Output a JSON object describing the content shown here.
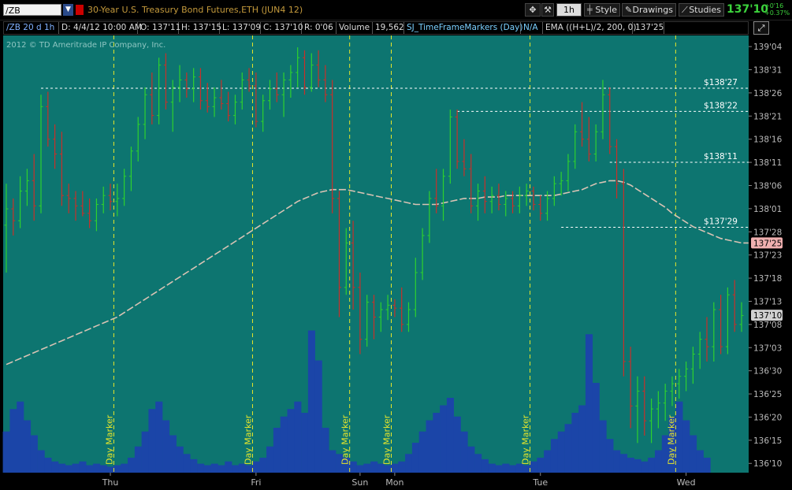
{
  "toolbar": {
    "symbol": "/ZB",
    "description": "30-Year U.S. Treasury Bond Futures,ETH (JUN4 12)",
    "timeframe": "1h",
    "style_label": "Style",
    "drawings_label": "Drawings",
    "studies_label": "Studies",
    "last_price": "137'10",
    "change_abs": "+0'16",
    "change_pct": "+0.37%"
  },
  "infobar": {
    "chart_id": "/ZB 20 d 1h",
    "date": "D: 4/4/12 10:00 AM",
    "open": "O: 137'11",
    "high": "H: 137'15",
    "low": "L: 137'09",
    "close": "C: 137'10",
    "range": "R: 0'06",
    "volume_label": "Volume",
    "volume_value": "19,562",
    "study_name": "SJ_TimeFrameMarkers (Day)",
    "study_value": "N/A",
    "ema_label": "EMA ((H+L)/2, 200, 0)",
    "ema_value": "137'25"
  },
  "copyright": "2012 © TD Ameritrade IP Company, Inc.",
  "colors": {
    "background": "#0d7570",
    "up_bar": "#2ed12e",
    "down_bar": "#c8302a",
    "doji_bar": "#e6e6e6",
    "volume": "#1b45a8",
    "marker_line": "#e6e62a",
    "ema_line": "#d9c3b4",
    "price_axis_bg": "#000000",
    "ema_badge": "#f0b0b0",
    "last_badge": "#d0d0d0"
  },
  "chart_data": {
    "type": "line",
    "title": "30-Year U.S. Treasury Bond Futures,ETH (JUN4 12)",
    "bar_interval": "1h",
    "ylim": [
      136.25,
      139.2
    ],
    "y_ticks": [
      "139'04",
      "138'31",
      "138'26",
      "138'21",
      "138'16",
      "138'11",
      "138'06",
      "138'01",
      "137'28",
      "137'23",
      "137'18",
      "137'13",
      "137'08",
      "137'03",
      "136'30",
      "136'25",
      "136'20",
      "136'15",
      "136'10"
    ],
    "x_tick_labels": [
      {
        "label": "Thu",
        "i": 15
      },
      {
        "label": "Fri",
        "i": 36
      },
      {
        "label": "Sun",
        "i": 51
      },
      {
        "label": "Mon",
        "i": 56
      },
      {
        "label": "Tue",
        "i": 77
      },
      {
        "label": "Wed",
        "i": 98
      }
    ],
    "day_markers": [
      {
        "label": "Day Marker",
        "i": 16
      },
      {
        "label": "Day Marker",
        "i": 36
      },
      {
        "label": "Day Marker",
        "i": 50
      },
      {
        "label": "Day Marker",
        "i": 56
      },
      {
        "label": "Day Marker",
        "i": 76
      },
      {
        "label": "Day Marker",
        "i": 97
      }
    ],
    "price_levels": [
      {
        "label": "$138'27",
        "value": 138.844,
        "from_i": 5,
        "to_i": 107
      },
      {
        "label": "$138'22",
        "value": 138.6875,
        "from_i": 65,
        "to_i": 107
      },
      {
        "label": "$138'11",
        "value": 138.344,
        "from_i": 87,
        "to_i": 107
      },
      {
        "label": "$137'29",
        "value": 137.906,
        "from_i": 80,
        "to_i": 107
      }
    ],
    "ema": {
      "label": "137'25",
      "values": [
        136.98,
        137.0,
        137.02,
        137.04,
        137.06,
        137.08,
        137.1,
        137.12,
        137.14,
        137.16,
        137.18,
        137.2,
        137.22,
        137.24,
        137.26,
        137.28,
        137.3,
        137.33,
        137.36,
        137.39,
        137.42,
        137.45,
        137.48,
        137.51,
        137.54,
        137.57,
        137.6,
        137.63,
        137.66,
        137.69,
        137.72,
        137.75,
        137.78,
        137.81,
        137.84,
        137.87,
        137.9,
        137.93,
        137.96,
        137.99,
        138.02,
        138.05,
        138.08,
        138.1,
        138.12,
        138.14,
        138.15,
        138.16,
        138.16,
        138.16,
        138.15,
        138.14,
        138.13,
        138.12,
        138.11,
        138.1,
        138.09,
        138.08,
        138.07,
        138.06,
        138.06,
        138.06,
        138.06,
        138.07,
        138.08,
        138.09,
        138.1,
        138.1,
        138.1,
        138.11,
        138.11,
        138.11,
        138.12,
        138.12,
        138.12,
        138.12,
        138.12,
        138.12,
        138.12,
        138.12,
        138.13,
        138.14,
        138.15,
        138.16,
        138.18,
        138.2,
        138.21,
        138.22,
        138.22,
        138.21,
        138.19,
        138.16,
        138.13,
        138.1,
        138.07,
        138.04,
        138.0,
        137.97,
        137.94,
        137.91,
        137.89,
        137.87,
        137.85,
        137.83,
        137.82,
        137.81,
        137.8,
        137.8
      ]
    },
    "last_price": {
      "label": "137'10",
      "value": 137.3125
    },
    "ohlc": [
      [
        137.92,
        138.2,
        137.6,
        138.03
      ],
      [
        138.03,
        138.1,
        137.85,
        137.95
      ],
      [
        137.95,
        138.25,
        137.9,
        138.15
      ],
      [
        138.15,
        138.3,
        138.05,
        138.22
      ],
      [
        138.22,
        138.4,
        137.95,
        138.05
      ],
      [
        138.05,
        138.8,
        138.0,
        138.72
      ],
      [
        138.72,
        138.82,
        138.45,
        138.5
      ],
      [
        138.5,
        138.6,
        138.3,
        138.4
      ],
      [
        138.4,
        138.55,
        138.05,
        138.12
      ],
      [
        138.12,
        138.2,
        138.0,
        138.1
      ],
      [
        138.1,
        138.15,
        137.95,
        138.05
      ],
      [
        138.05,
        138.15,
        137.98,
        138.0
      ],
      [
        138.0,
        138.1,
        137.9,
        137.95
      ],
      [
        137.95,
        138.1,
        137.88,
        138.06
      ],
      [
        138.06,
        138.18,
        138.0,
        138.12
      ],
      [
        138.12,
        138.2,
        138.02,
        138.08
      ],
      [
        138.08,
        138.2,
        137.98,
        138.1
      ],
      [
        138.1,
        138.3,
        138.05,
        138.25
      ],
      [
        138.25,
        138.45,
        138.15,
        138.42
      ],
      [
        138.42,
        138.65,
        138.35,
        138.6
      ],
      [
        138.6,
        138.85,
        138.5,
        138.8
      ],
      [
        138.8,
        138.95,
        138.6,
        138.66
      ],
      [
        138.66,
        139.05,
        138.6,
        139.0
      ],
      [
        139.0,
        139.08,
        138.7,
        138.75
      ],
      [
        138.75,
        138.9,
        138.55,
        138.85
      ],
      [
        138.85,
        139.0,
        138.75,
        138.9
      ],
      [
        138.9,
        138.95,
        138.78,
        138.84
      ],
      [
        138.84,
        138.98,
        138.75,
        138.92
      ],
      [
        138.92,
        138.98,
        138.7,
        138.76
      ],
      [
        138.76,
        138.88,
        138.68,
        138.72
      ],
      [
        138.72,
        138.85,
        138.65,
        138.78
      ],
      [
        138.78,
        138.9,
        138.7,
        138.74
      ],
      [
        138.74,
        138.82,
        138.62,
        138.66
      ],
      [
        138.66,
        138.8,
        138.6,
        138.75
      ],
      [
        138.75,
        138.95,
        138.7,
        138.9
      ],
      [
        138.9,
        138.98,
        138.82,
        138.86
      ],
      [
        138.86,
        138.95,
        138.58,
        138.62
      ],
      [
        138.62,
        138.8,
        138.55,
        138.76
      ],
      [
        138.76,
        138.9,
        138.7,
        138.84
      ],
      [
        138.84,
        138.95,
        138.75,
        138.8
      ],
      [
        138.8,
        138.95,
        138.65,
        138.9
      ],
      [
        138.9,
        139.0,
        138.78,
        138.95
      ],
      [
        138.95,
        139.12,
        138.85,
        139.05
      ],
      [
        139.05,
        139.1,
        138.8,
        138.85
      ],
      [
        138.85,
        139.08,
        138.82,
        139.0
      ],
      [
        139.0,
        139.1,
        138.85,
        138.9
      ],
      [
        138.9,
        139.0,
        138.75,
        138.8
      ],
      [
        138.8,
        138.9,
        138.0,
        138.1
      ],
      [
        138.1,
        138.15,
        137.3,
        137.5
      ],
      [
        137.5,
        137.9,
        137.45,
        137.8
      ],
      [
        137.8,
        137.95,
        137.35,
        137.5
      ],
      [
        137.5,
        137.6,
        137.05,
        137.15
      ],
      [
        137.15,
        137.45,
        137.1,
        137.4
      ],
      [
        137.4,
        137.45,
        137.15,
        137.3
      ],
      [
        137.3,
        137.4,
        137.2,
        137.35
      ],
      [
        137.35,
        137.45,
        137.28,
        137.38
      ],
      [
        137.38,
        137.42,
        137.3,
        137.36
      ],
      [
        137.36,
        137.5,
        137.2,
        137.25
      ],
      [
        137.25,
        137.4,
        137.2,
        137.35
      ],
      [
        137.35,
        137.7,
        137.3,
        137.6
      ],
      [
        137.6,
        137.9,
        137.55,
        137.85
      ],
      [
        137.85,
        138.15,
        137.8,
        138.1
      ],
      [
        138.1,
        138.3,
        138.0,
        138.05
      ],
      [
        138.05,
        138.3,
        137.95,
        138.25
      ],
      [
        138.25,
        138.7,
        138.2,
        138.65
      ],
      [
        138.65,
        138.7,
        138.3,
        138.35
      ],
      [
        138.35,
        138.5,
        138.25,
        138.3
      ],
      [
        138.3,
        138.4,
        138.0,
        138.05
      ],
      [
        138.05,
        138.2,
        137.95,
        138.15
      ],
      [
        138.15,
        138.25,
        138.0,
        138.08
      ],
      [
        138.08,
        138.18,
        138.0,
        138.12
      ],
      [
        138.12,
        138.2,
        138.02,
        138.06
      ],
      [
        138.06,
        138.15,
        137.98,
        138.1
      ],
      [
        138.1,
        138.15,
        138.0,
        138.05
      ],
      [
        138.05,
        138.18,
        138.0,
        138.12
      ],
      [
        138.12,
        138.2,
        138.05,
        138.15
      ],
      [
        138.15,
        138.18,
        138.02,
        138.06
      ],
      [
        138.06,
        138.12,
        137.95,
        138.0
      ],
      [
        138.0,
        138.15,
        137.95,
        138.1
      ],
      [
        138.1,
        138.25,
        138.05,
        138.2
      ],
      [
        138.2,
        138.28,
        138.12,
        138.22
      ],
      [
        138.22,
        138.4,
        138.15,
        138.35
      ],
      [
        138.35,
        138.6,
        138.3,
        138.55
      ],
      [
        138.55,
        138.75,
        138.45,
        138.5
      ],
      [
        138.5,
        138.65,
        138.35,
        138.4
      ],
      [
        138.4,
        138.6,
        138.35,
        138.55
      ],
      [
        138.55,
        138.9,
        138.5,
        138.8
      ],
      [
        138.8,
        138.85,
        138.4,
        138.45
      ],
      [
        138.45,
        138.5,
        138.1,
        138.2
      ],
      [
        138.2,
        138.3,
        136.9,
        137.0
      ],
      [
        137.0,
        137.1,
        136.55,
        136.7
      ],
      [
        136.7,
        136.9,
        136.45,
        136.8
      ],
      [
        136.8,
        136.9,
        136.5,
        136.6
      ],
      [
        136.6,
        136.75,
        136.45,
        136.68
      ],
      [
        136.68,
        136.8,
        136.55,
        136.72
      ],
      [
        136.72,
        136.85,
        136.6,
        136.8
      ],
      [
        136.8,
        136.9,
        136.7,
        136.85
      ],
      [
        136.85,
        136.95,
        136.75,
        136.9
      ],
      [
        136.9,
        137.0,
        136.8,
        136.95
      ],
      [
        136.95,
        137.1,
        136.85,
        137.05
      ],
      [
        137.05,
        137.2,
        136.95,
        137.15
      ],
      [
        137.15,
        137.3,
        137.0,
        137.1
      ],
      [
        137.1,
        137.4,
        137.0,
        137.35
      ],
      [
        137.35,
        137.45,
        137.05,
        137.1
      ],
      [
        137.1,
        137.5,
        137.05,
        137.45
      ],
      [
        137.45,
        137.55,
        137.2,
        137.25
      ],
      [
        137.25,
        137.4,
        137.2,
        137.31
      ]
    ],
    "volume_rel": [
      0.55,
      0.85,
      0.95,
      0.7,
      0.5,
      0.3,
      0.2,
      0.15,
      0.12,
      0.1,
      0.12,
      0.15,
      0.1,
      0.12,
      0.1,
      0.08,
      0.1,
      0.12,
      0.2,
      0.35,
      0.55,
      0.85,
      0.95,
      0.7,
      0.5,
      0.35,
      0.25,
      0.18,
      0.12,
      0.1,
      0.12,
      0.1,
      0.15,
      0.1,
      0.12,
      0.1,
      0.15,
      0.2,
      0.35,
      0.6,
      0.75,
      0.85,
      0.95,
      0.8,
      1.9,
      1.5,
      0.6,
      0.3,
      0.25,
      0.2,
      0.15,
      0.1,
      0.12,
      0.15,
      0.12,
      0.1,
      0.12,
      0.15,
      0.25,
      0.4,
      0.55,
      0.7,
      0.8,
      0.9,
      1.0,
      0.75,
      0.55,
      0.35,
      0.25,
      0.18,
      0.12,
      0.1,
      0.12,
      0.1,
      0.12,
      0.1,
      0.15,
      0.2,
      0.3,
      0.45,
      0.55,
      0.65,
      0.8,
      0.9,
      1.85,
      1.2,
      0.7,
      0.45,
      0.3,
      0.25,
      0.2,
      0.18,
      0.15,
      0.2,
      0.3,
      0.5,
      0.75,
      0.95,
      0.7,
      0.5,
      0.3,
      0.2
    ]
  }
}
